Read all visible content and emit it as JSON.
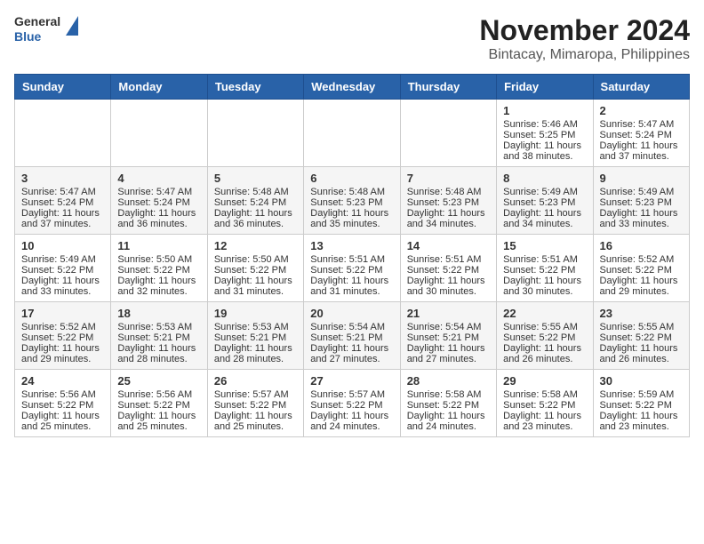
{
  "logo": {
    "line1": "General",
    "line2": "Blue"
  },
  "title": "November 2024",
  "subtitle": "Bintacay, Mimaropa, Philippines",
  "weekdays": [
    "Sunday",
    "Monday",
    "Tuesday",
    "Wednesday",
    "Thursday",
    "Friday",
    "Saturday"
  ],
  "weeks": [
    [
      {
        "day": "",
        "sunrise": "",
        "sunset": "",
        "daylight": ""
      },
      {
        "day": "",
        "sunrise": "",
        "sunset": "",
        "daylight": ""
      },
      {
        "day": "",
        "sunrise": "",
        "sunset": "",
        "daylight": ""
      },
      {
        "day": "",
        "sunrise": "",
        "sunset": "",
        "daylight": ""
      },
      {
        "day": "",
        "sunrise": "",
        "sunset": "",
        "daylight": ""
      },
      {
        "day": "1",
        "sunrise": "Sunrise: 5:46 AM",
        "sunset": "Sunset: 5:25 PM",
        "daylight": "Daylight: 11 hours and 38 minutes."
      },
      {
        "day": "2",
        "sunrise": "Sunrise: 5:47 AM",
        "sunset": "Sunset: 5:24 PM",
        "daylight": "Daylight: 11 hours and 37 minutes."
      }
    ],
    [
      {
        "day": "3",
        "sunrise": "Sunrise: 5:47 AM",
        "sunset": "Sunset: 5:24 PM",
        "daylight": "Daylight: 11 hours and 37 minutes."
      },
      {
        "day": "4",
        "sunrise": "Sunrise: 5:47 AM",
        "sunset": "Sunset: 5:24 PM",
        "daylight": "Daylight: 11 hours and 36 minutes."
      },
      {
        "day": "5",
        "sunrise": "Sunrise: 5:48 AM",
        "sunset": "Sunset: 5:24 PM",
        "daylight": "Daylight: 11 hours and 36 minutes."
      },
      {
        "day": "6",
        "sunrise": "Sunrise: 5:48 AM",
        "sunset": "Sunset: 5:23 PM",
        "daylight": "Daylight: 11 hours and 35 minutes."
      },
      {
        "day": "7",
        "sunrise": "Sunrise: 5:48 AM",
        "sunset": "Sunset: 5:23 PM",
        "daylight": "Daylight: 11 hours and 34 minutes."
      },
      {
        "day": "8",
        "sunrise": "Sunrise: 5:49 AM",
        "sunset": "Sunset: 5:23 PM",
        "daylight": "Daylight: 11 hours and 34 minutes."
      },
      {
        "day": "9",
        "sunrise": "Sunrise: 5:49 AM",
        "sunset": "Sunset: 5:23 PM",
        "daylight": "Daylight: 11 hours and 33 minutes."
      }
    ],
    [
      {
        "day": "10",
        "sunrise": "Sunrise: 5:49 AM",
        "sunset": "Sunset: 5:22 PM",
        "daylight": "Daylight: 11 hours and 33 minutes."
      },
      {
        "day": "11",
        "sunrise": "Sunrise: 5:50 AM",
        "sunset": "Sunset: 5:22 PM",
        "daylight": "Daylight: 11 hours and 32 minutes."
      },
      {
        "day": "12",
        "sunrise": "Sunrise: 5:50 AM",
        "sunset": "Sunset: 5:22 PM",
        "daylight": "Daylight: 11 hours and 31 minutes."
      },
      {
        "day": "13",
        "sunrise": "Sunrise: 5:51 AM",
        "sunset": "Sunset: 5:22 PM",
        "daylight": "Daylight: 11 hours and 31 minutes."
      },
      {
        "day": "14",
        "sunrise": "Sunrise: 5:51 AM",
        "sunset": "Sunset: 5:22 PM",
        "daylight": "Daylight: 11 hours and 30 minutes."
      },
      {
        "day": "15",
        "sunrise": "Sunrise: 5:51 AM",
        "sunset": "Sunset: 5:22 PM",
        "daylight": "Daylight: 11 hours and 30 minutes."
      },
      {
        "day": "16",
        "sunrise": "Sunrise: 5:52 AM",
        "sunset": "Sunset: 5:22 PM",
        "daylight": "Daylight: 11 hours and 29 minutes."
      }
    ],
    [
      {
        "day": "17",
        "sunrise": "Sunrise: 5:52 AM",
        "sunset": "Sunset: 5:22 PM",
        "daylight": "Daylight: 11 hours and 29 minutes."
      },
      {
        "day": "18",
        "sunrise": "Sunrise: 5:53 AM",
        "sunset": "Sunset: 5:21 PM",
        "daylight": "Daylight: 11 hours and 28 minutes."
      },
      {
        "day": "19",
        "sunrise": "Sunrise: 5:53 AM",
        "sunset": "Sunset: 5:21 PM",
        "daylight": "Daylight: 11 hours and 28 minutes."
      },
      {
        "day": "20",
        "sunrise": "Sunrise: 5:54 AM",
        "sunset": "Sunset: 5:21 PM",
        "daylight": "Daylight: 11 hours and 27 minutes."
      },
      {
        "day": "21",
        "sunrise": "Sunrise: 5:54 AM",
        "sunset": "Sunset: 5:21 PM",
        "daylight": "Daylight: 11 hours and 27 minutes."
      },
      {
        "day": "22",
        "sunrise": "Sunrise: 5:55 AM",
        "sunset": "Sunset: 5:22 PM",
        "daylight": "Daylight: 11 hours and 26 minutes."
      },
      {
        "day": "23",
        "sunrise": "Sunrise: 5:55 AM",
        "sunset": "Sunset: 5:22 PM",
        "daylight": "Daylight: 11 hours and 26 minutes."
      }
    ],
    [
      {
        "day": "24",
        "sunrise": "Sunrise: 5:56 AM",
        "sunset": "Sunset: 5:22 PM",
        "daylight": "Daylight: 11 hours and 25 minutes."
      },
      {
        "day": "25",
        "sunrise": "Sunrise: 5:56 AM",
        "sunset": "Sunset: 5:22 PM",
        "daylight": "Daylight: 11 hours and 25 minutes."
      },
      {
        "day": "26",
        "sunrise": "Sunrise: 5:57 AM",
        "sunset": "Sunset: 5:22 PM",
        "daylight": "Daylight: 11 hours and 25 minutes."
      },
      {
        "day": "27",
        "sunrise": "Sunrise: 5:57 AM",
        "sunset": "Sunset: 5:22 PM",
        "daylight": "Daylight: 11 hours and 24 minutes."
      },
      {
        "day": "28",
        "sunrise": "Sunrise: 5:58 AM",
        "sunset": "Sunset: 5:22 PM",
        "daylight": "Daylight: 11 hours and 24 minutes."
      },
      {
        "day": "29",
        "sunrise": "Sunrise: 5:58 AM",
        "sunset": "Sunset: 5:22 PM",
        "daylight": "Daylight: 11 hours and 23 minutes."
      },
      {
        "day": "30",
        "sunrise": "Sunrise: 5:59 AM",
        "sunset": "Sunset: 5:22 PM",
        "daylight": "Daylight: 11 hours and 23 minutes."
      }
    ]
  ]
}
